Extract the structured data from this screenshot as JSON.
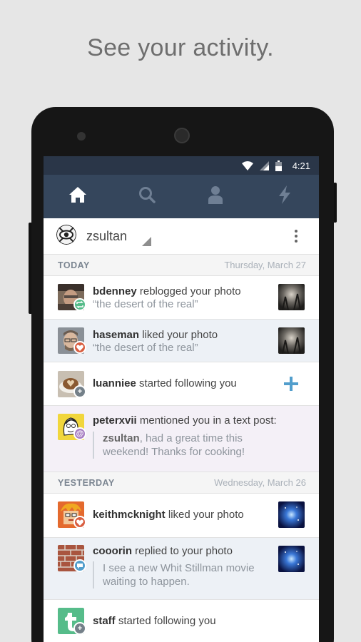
{
  "headline": "See your activity.",
  "status_bar": {
    "time": "4:21"
  },
  "nav": {
    "items": [
      {
        "name": "home",
        "icon": "home-icon",
        "active": true
      },
      {
        "name": "search",
        "icon": "search-icon",
        "active": false
      },
      {
        "name": "account",
        "icon": "person-icon",
        "active": false
      },
      {
        "name": "activity",
        "icon": "lightning-icon",
        "active": false
      }
    ]
  },
  "account": {
    "username": "zsultan"
  },
  "sections": {
    "today": {
      "label": "TODAY",
      "date": "Thursday, March 27"
    },
    "yesterday": {
      "label": "YESTERDAY",
      "date": "Wednesday, March 26"
    }
  },
  "activity": {
    "bdenney": {
      "user": "bdenney",
      "action": " reblogged your photo",
      "quote": "“the desert of the real”",
      "badge": "reblog-icon"
    },
    "haseman": {
      "user": "haseman",
      "action": " liked your photo",
      "quote": "“the desert of the real”",
      "badge": "heart-icon"
    },
    "luanniee": {
      "user": "luanniee",
      "action": " started following you",
      "badge": "plus-icon"
    },
    "peterxvii": {
      "user": "peterxvii",
      "action": " mentioned you in a text post:",
      "mention_user": "zsultan",
      "mention_text_1": ", had a great time this",
      "mention_text_2": "weekend! Thanks for cooking!",
      "badge": "at-icon"
    },
    "keithmcknight": {
      "user": "keithmcknight",
      "action": " liked your photo",
      "badge": "heart-icon"
    },
    "cooorin": {
      "user": "cooorin",
      "action": " replied to your photo",
      "reply_1": "I see a new Whit Stillman movie",
      "reply_2": "waiting to happen.",
      "badge": "chat-icon"
    },
    "staff": {
      "user": "staff",
      "action": " started following you",
      "badge": "plus-icon"
    }
  },
  "colors": {
    "navbar": "#35465c",
    "statusbar": "#2a3648",
    "reblog": "#56bc8a",
    "like": "#d95e40",
    "follow": "#748089",
    "mention": "#a77dc2",
    "reply": "#529ecc",
    "follow_plus": "#529ecc"
  }
}
